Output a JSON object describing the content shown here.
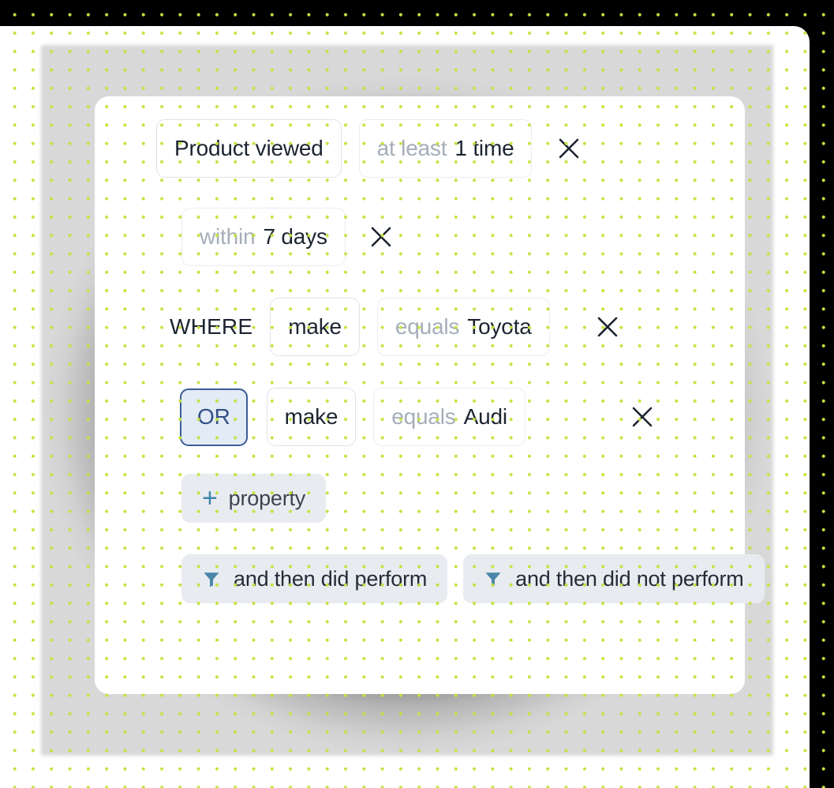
{
  "theme": {
    "page_background": "#000000",
    "sheet_background": "#ffffff",
    "card_background": "#ffffff",
    "dot_color": "#c6e23f",
    "accent_blue": "#3f87ab",
    "or_fill": "#e2ebf6",
    "or_border": "#3b5c99",
    "or_text": "#324f85",
    "pill_background": "#e8ecf1",
    "chip_border": "#e4e8ee",
    "muted_text": "#a5aeb9",
    "primary_text": "#1c2430"
  },
  "builder": {
    "rows": [
      {
        "id": "event",
        "keyword": "",
        "chips": [
          {
            "name": "event-chip",
            "muted": "",
            "value": "Product viewed"
          },
          {
            "name": "frequency-chip",
            "muted": "at least",
            "value": "1 time"
          }
        ],
        "remove_label": "×"
      },
      {
        "id": "timeframe",
        "keyword": "",
        "chips": [
          {
            "name": "timeframe-chip",
            "muted": "within",
            "value": "7 days"
          }
        ],
        "remove_label": "×"
      },
      {
        "id": "where-make-toyota",
        "keyword": "WHERE",
        "chips": [
          {
            "name": "property-chip",
            "muted": "",
            "value": "make"
          },
          {
            "name": "condition-chip",
            "muted": "equals",
            "value": "Toyota"
          }
        ],
        "remove_label": "×"
      },
      {
        "id": "or-make-audi",
        "keyword": "OR",
        "chips": [
          {
            "name": "property-chip",
            "muted": "",
            "value": "make"
          },
          {
            "name": "condition-chip",
            "muted": "equals",
            "value": "Audi"
          }
        ],
        "remove_label": "×"
      }
    ],
    "add_property": {
      "icon": "plus-icon",
      "plus_glyph": "+",
      "label": "property"
    },
    "actions": [
      {
        "id": "and-then-did-perform",
        "icon": "funnel-icon",
        "label": "and then did perform"
      },
      {
        "id": "and-then-did-not-perform",
        "icon": "funnel-icon",
        "label": "and then did not perform"
      }
    ]
  }
}
